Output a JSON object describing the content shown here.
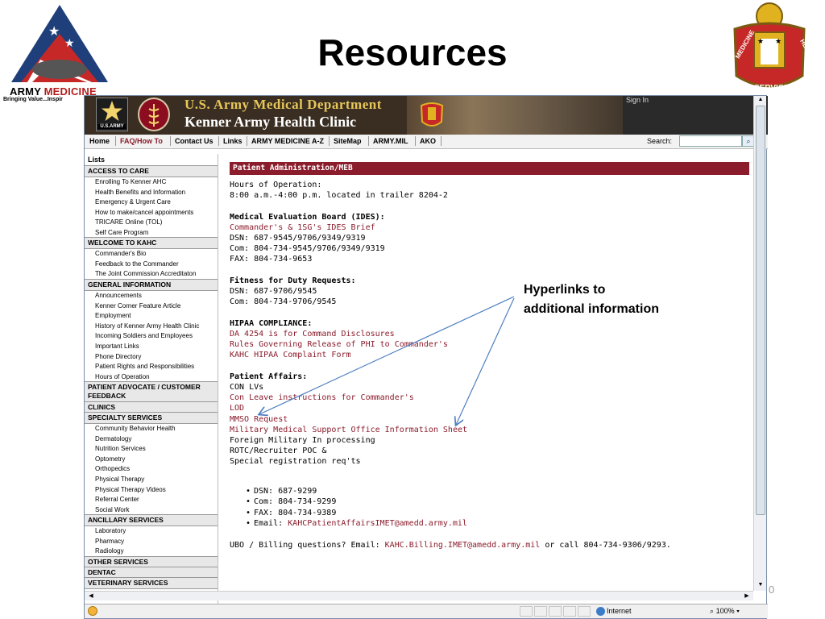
{
  "slide": {
    "title": "Resources",
    "logo_left": {
      "brand_prefix": "ARMY ",
      "brand_suffix": "MEDICINE",
      "tagline": "Bringing Value...Inspir"
    },
    "logo_right": {
      "left_text": "MEDICINE",
      "right_text": "HEALTH",
      "bottom_text": "SERVICE"
    },
    "slide_number": "0",
    "annotation": [
      "Hyperlinks to",
      "additional information"
    ],
    "colors": {
      "maroon": "#8a1c2b",
      "arrow": "#4f7fc2"
    }
  },
  "banner": {
    "army_label": "U.S.ARMY",
    "department": "U.S. Army Medical Department",
    "clinic": "Kenner Army Health Clinic",
    "sign_in": "Sign In"
  },
  "navbar": {
    "items": [
      "Home",
      "FAQ/How To",
      "Contact Us",
      "Links",
      "ARMY MEDICINE A-Z",
      "SiteMap",
      "ARMY.MIL",
      "AKO"
    ],
    "search_label": "Search:",
    "search_value": "",
    "search_icon": "search-icon"
  },
  "sidebar": {
    "lists_title": "Lists",
    "access_to_care": {
      "heading": "ACCESS TO CARE",
      "items": [
        "Enrolling To Kenner AHC",
        "Health Benefits and Information",
        "Emergency & Urgent Care",
        "How to make/cancel appointments",
        "TRICARE Online (TOL)",
        "Self Care Program"
      ]
    },
    "welcome": {
      "heading": "WELCOME TO KAHC",
      "items": [
        "Commander's Bio",
        "Feedback to the Commander",
        "The Joint Commission Accreditaton"
      ]
    },
    "general": {
      "heading": "GENERAL INFORMATION",
      "items": [
        "Announcements",
        "Kenner Corner Feature Article",
        "Employment",
        "History of Kenner Army Health Clinic",
        "Incoming Soldiers and Employees",
        "Important Links",
        "Phone Directory",
        "Patient Rights and Responsibilities",
        "Hours of Operation"
      ]
    },
    "patient_advocate": {
      "heading_line1": "PATIENT ADVOCATE / CUSTOMER",
      "heading_line2": "FEEDBACK"
    },
    "clinics": {
      "heading": "CLINICS"
    },
    "specialty": {
      "heading": "SPECIALTY SERVICES",
      "items": [
        "Community Behavior Health",
        "Dermatology",
        "Nutrition Services",
        "Optometry",
        "Orthopedics",
        "Physical Therapy",
        "Physical Therapy Videos",
        "Referral Center",
        "Social Work"
      ]
    },
    "ancillary": {
      "heading": "ANCILLARY SERVICES",
      "items": [
        "Laboratory",
        "Pharmacy",
        "Radiology"
      ]
    },
    "other": {
      "heading": "OTHER SERVICES"
    },
    "dentac": {
      "heading": "DENTAC"
    },
    "veterinary": {
      "heading": "VETERINARY SERVICES"
    }
  },
  "content": {
    "header": "Patient Administration/MEB",
    "hours_title": "Hours of Operation:",
    "hours_text": "8:00 a.m.-4:00 p.m. located in trailer 8204-2",
    "meb_title": "Medical Evaluation Board (IDES):",
    "meb_link": "Commander's & 1SG's IDES Brief",
    "meb_dsn": "DSN: 687-9545/9706/9349/9319",
    "meb_com": "Com: 804-734-9545/9706/9349/9319",
    "meb_fax": "FAX:  804-734-9653",
    "ffd_title": "Fitness for Duty Requests:",
    "ffd_dsn": "DSN: 687-9706/9545",
    "ffd_com": "Com: 804-734-9706/9545",
    "hipaa_title": "HIPAA COMPLIANCE:",
    "hipaa_links": [
      "DA 4254 is for Command Disclosures",
      "Rules Governing Release of PHI to Commander's",
      "KAHC HIPAA Complaint Form"
    ],
    "pa_title": "Patient Affairs:",
    "pa_con": "CON LVs",
    "pa_links": [
      "Con Leave instructions for Commander's",
      "LOD",
      "MMSO Request",
      "Military Medical Support Office Information Sheet"
    ],
    "pa_text": [
      "Foreign Military In processing",
      "ROTC/Recruiter POC &",
      "Special registration req'ts"
    ],
    "bullets": [
      "DSN: 687-9299",
      "Com: 804-734-9299",
      "FAX:  804-734-9389"
    ],
    "bullet_email_label": "Email: ",
    "bullet_email_link": "KAHCPatientAffairsIMET@amedd.army.mil",
    "ubo_prefix": "UBO / Billing questions? Email: ",
    "ubo_link": "KAHC.Billing.IMET@amedd.army.mil",
    "ubo_suffix": " or call 804-734-9306/9293."
  },
  "statusbar": {
    "zone": "Internet",
    "zoom": "100%"
  }
}
